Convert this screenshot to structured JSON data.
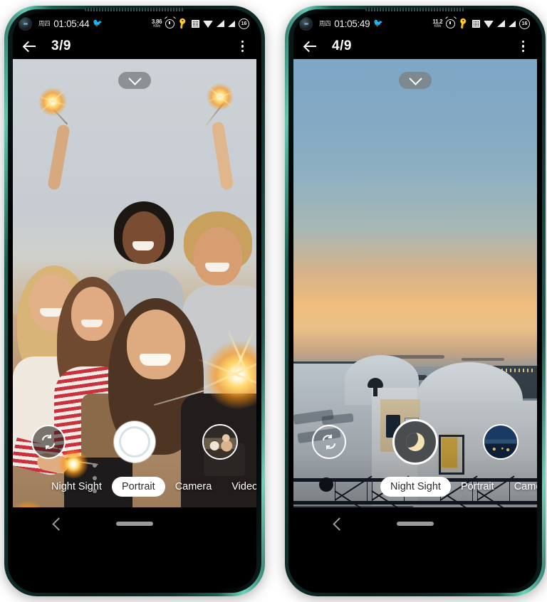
{
  "phones": [
    {
      "id": "left",
      "status": {
        "day": "周四",
        "time": "01:05:44",
        "bird_icon": "bird-icon",
        "net_speed_value": "3.86",
        "net_speed_unit": "KB/s",
        "alarm_icon": "alarm-icon",
        "key_icon": "key-icon",
        "qr_icon": "qr-icon",
        "wifi_icon": "wifi-icon",
        "signal_icon_1": "signal-icon",
        "signal_icon_2": "signal-icon",
        "battery_level": "16"
      },
      "appbar": {
        "back_icon": "back-arrow-icon",
        "counter": "3/9",
        "menu_icon": "kebab-menu-icon"
      },
      "viewfinder": {
        "expand_icon": "chevron-down-icon",
        "scene": "group-selfie-with-sparklers",
        "flip_icon": "flip-camera-icon",
        "shutter_icon": "shutter-button",
        "thumbnail_icon": "gallery-thumbnail"
      },
      "modes": [
        {
          "label": "Night Sight",
          "active": false
        },
        {
          "label": "Portrait",
          "active": true
        },
        {
          "label": "Camera",
          "active": false
        },
        {
          "label": "Video",
          "active": false
        }
      ],
      "nav": {
        "back_icon": "nav-back-icon",
        "home_icon": "nav-home-indicator"
      }
    },
    {
      "id": "right",
      "status": {
        "day": "周四",
        "time": "01:05:49",
        "bird_icon": "bird-icon",
        "net_speed_value": "11.2",
        "net_speed_unit": "KB/s",
        "alarm_icon": "alarm-icon",
        "key_icon": "key-icon",
        "qr_icon": "qr-icon",
        "wifi_icon": "wifi-icon",
        "signal_icon_1": "signal-icon",
        "signal_icon_2": "signal-icon",
        "battery_level": "16"
      },
      "appbar": {
        "back_icon": "back-arrow-icon",
        "counter": "4/9",
        "menu_icon": "kebab-menu-icon"
      },
      "viewfinder": {
        "expand_icon": "chevron-down-icon",
        "scene": "santorini-sunset-seascape",
        "flip_icon": "flip-camera-icon",
        "shutter_icon": "night-sight-moon-button",
        "thumbnail_icon": "gallery-thumbnail"
      },
      "modes": [
        {
          "label": "Night Sight",
          "active": true
        },
        {
          "label": "Portrait",
          "active": false
        },
        {
          "label": "Camera",
          "active": false
        }
      ],
      "nav": {
        "back_icon": "nav-back-icon",
        "home_icon": "nav-home-indicator"
      }
    }
  ],
  "colors": {
    "frame": "#2f6f63",
    "frame_highlight": "#6fd3bd",
    "screen_bg": "#000000",
    "mode_active_bg": "#ffffff",
    "mode_text": "#ffffff",
    "nav_gray": "#9a9a9a"
  }
}
